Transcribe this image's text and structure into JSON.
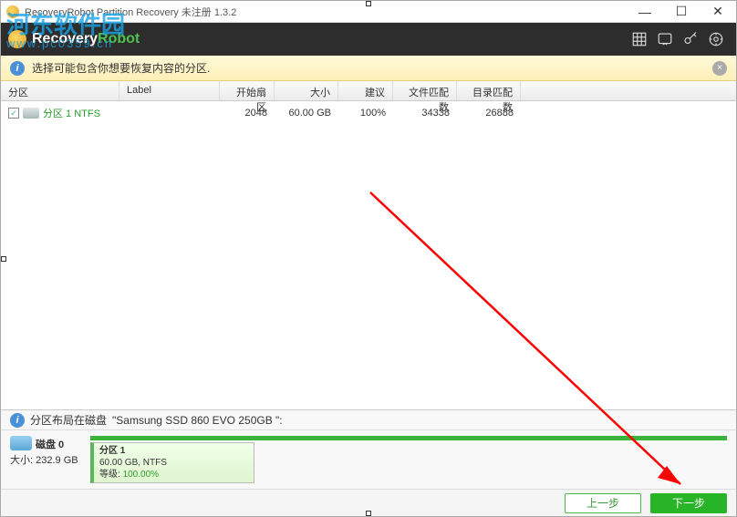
{
  "title": "RecoveryRobot Partition Recovery 未注册 1.3.2",
  "logo": {
    "part1": "Recovery",
    "part2": "Robot"
  },
  "watermark": {
    "main": "河东软件园",
    "sub": "www.pc0359.cn"
  },
  "infobar": {
    "text": "选择可能包含你想要恢复内容的分区.",
    "close": "×"
  },
  "columns": {
    "partition": "分区",
    "label": "Label",
    "start": "开始扇区",
    "size": "大小",
    "suggest": "建议",
    "files": "文件匹配数",
    "dirs": "目录匹配数"
  },
  "rows": [
    {
      "checked": true,
      "name": "分区 1 NTFS",
      "label": "",
      "start": "2048",
      "size": "60.00 GB",
      "suggest": "100%",
      "files": "34338",
      "dirs": "26888"
    }
  ],
  "bottom": {
    "layout_prefix": "分区布局在磁盘",
    "disk_model": "\"Samsung SSD 860 EVO 250GB \":",
    "disk_label": "磁盘 0",
    "size_label": "大小:",
    "disk_size": "232.9 GB",
    "part_title": "分区 1",
    "part_info": "60.00 GB, NTFS",
    "part_rate_label": "等级:",
    "part_rate_val": "100.00%"
  },
  "buttons": {
    "prev": "上一步",
    "next": "下一步"
  },
  "winbtn": {
    "min": "—",
    "max": "☐",
    "close": "✕"
  }
}
